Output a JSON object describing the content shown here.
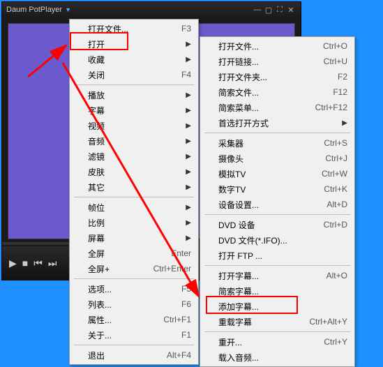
{
  "titlebar": {
    "title": "Daum PotPlayer"
  },
  "menu1": {
    "items": [
      {
        "label": "打开文件...",
        "shortcut": "F3",
        "sub": false
      },
      {
        "label": "打开",
        "shortcut": "",
        "sub": true
      },
      {
        "label": "收藏",
        "shortcut": "",
        "sub": true
      },
      {
        "label": "关闭",
        "shortcut": "F4",
        "sub": false
      }
    ],
    "group2": [
      {
        "label": "播放",
        "shortcut": "",
        "sub": true
      },
      {
        "label": "字幕",
        "shortcut": "",
        "sub": true
      },
      {
        "label": "视频",
        "shortcut": "",
        "sub": true
      },
      {
        "label": "音频",
        "shortcut": "",
        "sub": true
      },
      {
        "label": "滤镜",
        "shortcut": "",
        "sub": true
      },
      {
        "label": "皮肤",
        "shortcut": "",
        "sub": true
      },
      {
        "label": "其它",
        "shortcut": "",
        "sub": true
      }
    ],
    "group3": [
      {
        "label": "帧位",
        "shortcut": "",
        "sub": true
      },
      {
        "label": "比例",
        "shortcut": "",
        "sub": true
      },
      {
        "label": "屏幕",
        "shortcut": "",
        "sub": true
      },
      {
        "label": "全屏",
        "shortcut": "Enter",
        "sub": false
      },
      {
        "label": "全屏+",
        "shortcut": "Ctrl+Enter",
        "sub": false
      }
    ],
    "group4": [
      {
        "label": "选项...",
        "shortcut": "F5",
        "sub": false
      },
      {
        "label": "列表...",
        "shortcut": "F6",
        "sub": false
      },
      {
        "label": "属性...",
        "shortcut": "Ctrl+F1",
        "sub": false
      },
      {
        "label": "关于...",
        "shortcut": "F1",
        "sub": false
      }
    ],
    "group5": [
      {
        "label": "退出",
        "shortcut": "Alt+F4",
        "sub": false
      }
    ]
  },
  "menu2": {
    "g1": [
      {
        "label": "打开文件...",
        "shortcut": "Ctrl+O"
      },
      {
        "label": "打开链接...",
        "shortcut": "Ctrl+U"
      },
      {
        "label": "打开文件夹...",
        "shortcut": "F2"
      },
      {
        "label": "简索文件...",
        "shortcut": "F12"
      },
      {
        "label": "简索菜单...",
        "shortcut": "Ctrl+F12"
      },
      {
        "label": "首选打开方式",
        "shortcut": "",
        "sub": true
      }
    ],
    "g2": [
      {
        "label": "采集器",
        "shortcut": "Ctrl+S"
      },
      {
        "label": "摄像头",
        "shortcut": "Ctrl+J"
      },
      {
        "label": "模拟TV",
        "shortcut": "Ctrl+W"
      },
      {
        "label": "数字TV",
        "shortcut": "Ctrl+K"
      },
      {
        "label": "设备设置...",
        "shortcut": "Alt+D"
      }
    ],
    "g3": [
      {
        "label": "DVD 设备",
        "shortcut": "Ctrl+D"
      },
      {
        "label": "DVD 文件(*.IFO)...",
        "shortcut": ""
      },
      {
        "label": "打开 FTP ...",
        "shortcut": ""
      }
    ],
    "g4": [
      {
        "label": "打开字幕...",
        "shortcut": "Alt+O"
      },
      {
        "label": "简索字幕...",
        "shortcut": ""
      },
      {
        "label": "添加字幕...",
        "shortcut": ""
      },
      {
        "label": "重载字幕",
        "shortcut": "Ctrl+Alt+Y"
      }
    ],
    "g5": [
      {
        "label": "重开...",
        "shortcut": "Ctrl+Y"
      },
      {
        "label": "载入音频...",
        "shortcut": ""
      }
    ]
  }
}
